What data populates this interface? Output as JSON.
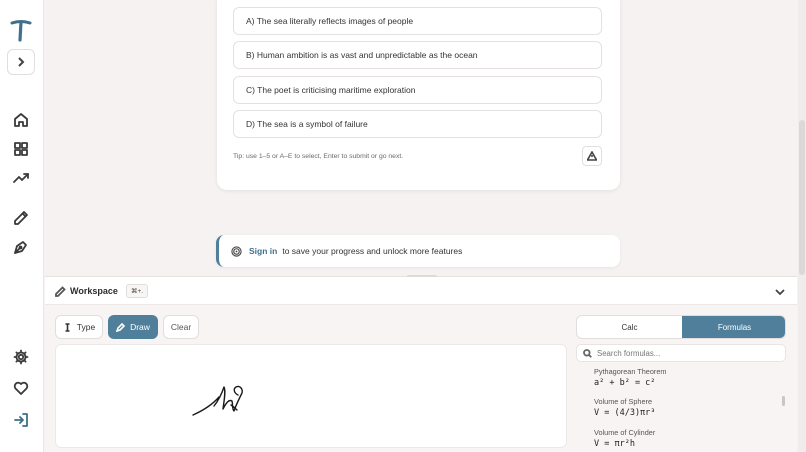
{
  "quiz": {
    "options": [
      "A) The sea literally reflects images of people",
      "B) Human ambition is as vast and unpredictable as the ocean",
      "C) The poet is criticising maritime exploration",
      "D) The sea is a symbol of failure"
    ],
    "tip": "Tip: use 1–5 or A–E to select, Enter to submit or go next."
  },
  "signin": {
    "link": "Sign in",
    "text": "to save your progress and unlock more features"
  },
  "workspace": {
    "title": "Workspace",
    "shortcut": "⌘+.",
    "type_label": "Type",
    "draw_label": "Draw",
    "clear_label": "Clear",
    "calc_label": "Calc",
    "formulas_label": "Formulas",
    "search_placeholder": "Search formulas...",
    "formulas": [
      {
        "name": "Pythagorean Theorem",
        "expr": "a² + b² = c²"
      },
      {
        "name": "Volume of Sphere",
        "expr": "V = (4/3)πr³"
      },
      {
        "name": "Volume of Cylinder",
        "expr": "V = πr²h"
      }
    ]
  },
  "colors": {
    "accent": "#4f7f9b",
    "background": "#f5f2f1"
  }
}
